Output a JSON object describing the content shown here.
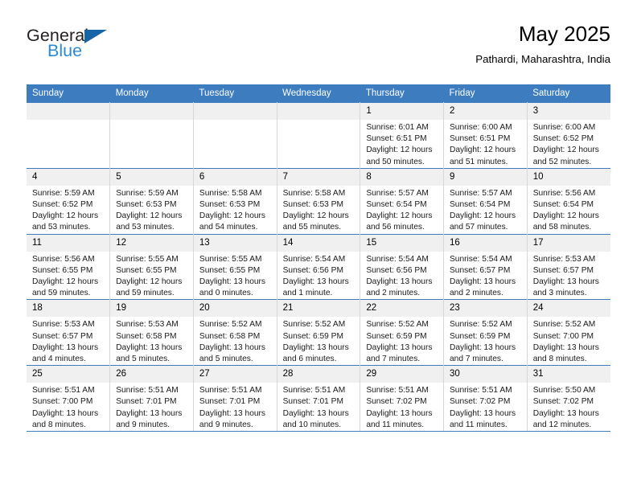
{
  "brand": {
    "name_part1": "General",
    "name_part2": "Blue",
    "accent_color": "#2b8ad6",
    "triangle_color": "#1565a8"
  },
  "header": {
    "title": "May 2025",
    "subtitle": "Pathardi, Maharashtra, India"
  },
  "calendar": {
    "header_bg": "#3c7cbf",
    "weekdays": [
      "Sunday",
      "Monday",
      "Tuesday",
      "Wednesday",
      "Thursday",
      "Friday",
      "Saturday"
    ],
    "weeks": [
      [
        {
          "day": "",
          "lines": []
        },
        {
          "day": "",
          "lines": []
        },
        {
          "day": "",
          "lines": []
        },
        {
          "day": "",
          "lines": []
        },
        {
          "day": "1",
          "lines": [
            "Sunrise: 6:01 AM",
            "Sunset: 6:51 PM",
            "Daylight: 12 hours",
            "and 50 minutes."
          ]
        },
        {
          "day": "2",
          "lines": [
            "Sunrise: 6:00 AM",
            "Sunset: 6:51 PM",
            "Daylight: 12 hours",
            "and 51 minutes."
          ]
        },
        {
          "day": "3",
          "lines": [
            "Sunrise: 6:00 AM",
            "Sunset: 6:52 PM",
            "Daylight: 12 hours",
            "and 52 minutes."
          ]
        }
      ],
      [
        {
          "day": "4",
          "lines": [
            "Sunrise: 5:59 AM",
            "Sunset: 6:52 PM",
            "Daylight: 12 hours",
            "and 53 minutes."
          ]
        },
        {
          "day": "5",
          "lines": [
            "Sunrise: 5:59 AM",
            "Sunset: 6:53 PM",
            "Daylight: 12 hours",
            "and 53 minutes."
          ]
        },
        {
          "day": "6",
          "lines": [
            "Sunrise: 5:58 AM",
            "Sunset: 6:53 PM",
            "Daylight: 12 hours",
            "and 54 minutes."
          ]
        },
        {
          "day": "7",
          "lines": [
            "Sunrise: 5:58 AM",
            "Sunset: 6:53 PM",
            "Daylight: 12 hours",
            "and 55 minutes."
          ]
        },
        {
          "day": "8",
          "lines": [
            "Sunrise: 5:57 AM",
            "Sunset: 6:54 PM",
            "Daylight: 12 hours",
            "and 56 minutes."
          ]
        },
        {
          "day": "9",
          "lines": [
            "Sunrise: 5:57 AM",
            "Sunset: 6:54 PM",
            "Daylight: 12 hours",
            "and 57 minutes."
          ]
        },
        {
          "day": "10",
          "lines": [
            "Sunrise: 5:56 AM",
            "Sunset: 6:54 PM",
            "Daylight: 12 hours",
            "and 58 minutes."
          ]
        }
      ],
      [
        {
          "day": "11",
          "lines": [
            "Sunrise: 5:56 AM",
            "Sunset: 6:55 PM",
            "Daylight: 12 hours",
            "and 59 minutes."
          ]
        },
        {
          "day": "12",
          "lines": [
            "Sunrise: 5:55 AM",
            "Sunset: 6:55 PM",
            "Daylight: 12 hours",
            "and 59 minutes."
          ]
        },
        {
          "day": "13",
          "lines": [
            "Sunrise: 5:55 AM",
            "Sunset: 6:55 PM",
            "Daylight: 13 hours",
            "and 0 minutes."
          ]
        },
        {
          "day": "14",
          "lines": [
            "Sunrise: 5:54 AM",
            "Sunset: 6:56 PM",
            "Daylight: 13 hours",
            "and 1 minute."
          ]
        },
        {
          "day": "15",
          "lines": [
            "Sunrise: 5:54 AM",
            "Sunset: 6:56 PM",
            "Daylight: 13 hours",
            "and 2 minutes."
          ]
        },
        {
          "day": "16",
          "lines": [
            "Sunrise: 5:54 AM",
            "Sunset: 6:57 PM",
            "Daylight: 13 hours",
            "and 2 minutes."
          ]
        },
        {
          "day": "17",
          "lines": [
            "Sunrise: 5:53 AM",
            "Sunset: 6:57 PM",
            "Daylight: 13 hours",
            "and 3 minutes."
          ]
        }
      ],
      [
        {
          "day": "18",
          "lines": [
            "Sunrise: 5:53 AM",
            "Sunset: 6:57 PM",
            "Daylight: 13 hours",
            "and 4 minutes."
          ]
        },
        {
          "day": "19",
          "lines": [
            "Sunrise: 5:53 AM",
            "Sunset: 6:58 PM",
            "Daylight: 13 hours",
            "and 5 minutes."
          ]
        },
        {
          "day": "20",
          "lines": [
            "Sunrise: 5:52 AM",
            "Sunset: 6:58 PM",
            "Daylight: 13 hours",
            "and 5 minutes."
          ]
        },
        {
          "day": "21",
          "lines": [
            "Sunrise: 5:52 AM",
            "Sunset: 6:59 PM",
            "Daylight: 13 hours",
            "and 6 minutes."
          ]
        },
        {
          "day": "22",
          "lines": [
            "Sunrise: 5:52 AM",
            "Sunset: 6:59 PM",
            "Daylight: 13 hours",
            "and 7 minutes."
          ]
        },
        {
          "day": "23",
          "lines": [
            "Sunrise: 5:52 AM",
            "Sunset: 6:59 PM",
            "Daylight: 13 hours",
            "and 7 minutes."
          ]
        },
        {
          "day": "24",
          "lines": [
            "Sunrise: 5:52 AM",
            "Sunset: 7:00 PM",
            "Daylight: 13 hours",
            "and 8 minutes."
          ]
        }
      ],
      [
        {
          "day": "25",
          "lines": [
            "Sunrise: 5:51 AM",
            "Sunset: 7:00 PM",
            "Daylight: 13 hours",
            "and 8 minutes."
          ]
        },
        {
          "day": "26",
          "lines": [
            "Sunrise: 5:51 AM",
            "Sunset: 7:01 PM",
            "Daylight: 13 hours",
            "and 9 minutes."
          ]
        },
        {
          "day": "27",
          "lines": [
            "Sunrise: 5:51 AM",
            "Sunset: 7:01 PM",
            "Daylight: 13 hours",
            "and 9 minutes."
          ]
        },
        {
          "day": "28",
          "lines": [
            "Sunrise: 5:51 AM",
            "Sunset: 7:01 PM",
            "Daylight: 13 hours",
            "and 10 minutes."
          ]
        },
        {
          "day": "29",
          "lines": [
            "Sunrise: 5:51 AM",
            "Sunset: 7:02 PM",
            "Daylight: 13 hours",
            "and 11 minutes."
          ]
        },
        {
          "day": "30",
          "lines": [
            "Sunrise: 5:51 AM",
            "Sunset: 7:02 PM",
            "Daylight: 13 hours",
            "and 11 minutes."
          ]
        },
        {
          "day": "31",
          "lines": [
            "Sunrise: 5:50 AM",
            "Sunset: 7:02 PM",
            "Daylight: 13 hours",
            "and 12 minutes."
          ]
        }
      ]
    ]
  }
}
